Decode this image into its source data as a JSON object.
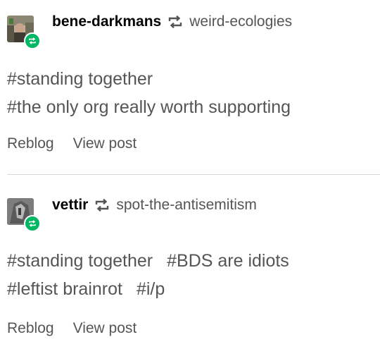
{
  "posts": [
    {
      "username": "bene-darkmans",
      "reblogged_from": "weird-ecologies",
      "tags": [
        "#standing together",
        "#the only org really worth supporting"
      ],
      "actions": {
        "reblog": "Reblog",
        "view_post": "View post"
      }
    },
    {
      "username": "vettir",
      "reblogged_from": "spot-the-antisemitism",
      "tags": [
        "#standing together",
        "#BDS are idiots",
        "#leftist brainrot",
        "#i/p"
      ],
      "actions": {
        "reblog": "Reblog",
        "view_post": "View post"
      }
    }
  ],
  "colors": {
    "reblog_badge": "#00b863",
    "text_secondary": "#555555",
    "divider": "#d9d9d9"
  },
  "icons": {
    "reblog": "reblog-icon"
  }
}
